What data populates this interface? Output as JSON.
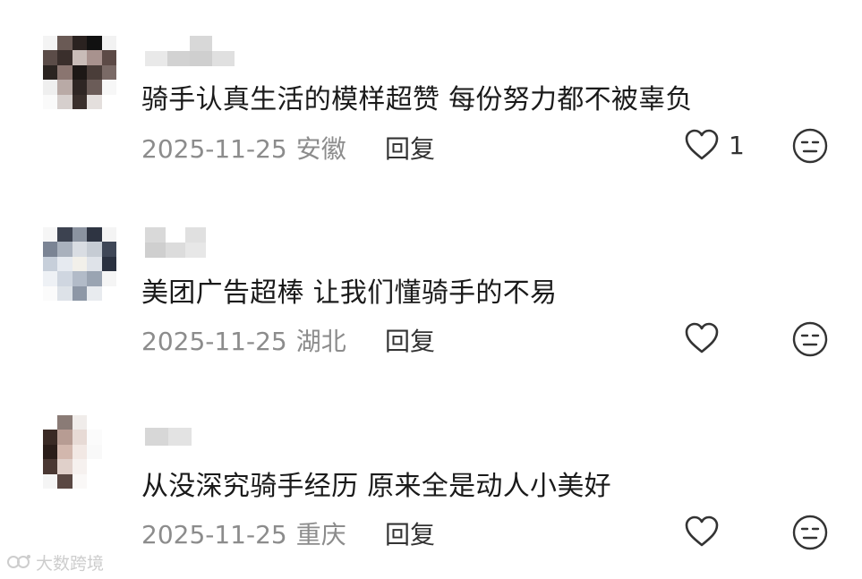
{
  "comments": [
    {
      "text": "骑手认真生活的模样超赞 每份努力都不被辜负",
      "date": "2025-11-25",
      "location": "安徽",
      "reply_label": "回复",
      "like_count": "1",
      "like_icon": "heart-outline-icon",
      "dislike_icon": "neutral-face-icon"
    },
    {
      "text": "美团广告超棒 让我们懂骑手的不易",
      "date": "2025-11-25",
      "location": "湖北",
      "reply_label": "回复",
      "like_count": "",
      "like_icon": "heart-outline-icon",
      "dislike_icon": "neutral-face-icon"
    },
    {
      "text": "从没深究骑手经历 原来全是动人小美好",
      "date": "2025-11-25",
      "location": "重庆",
      "reply_label": "回复",
      "like_count": "",
      "like_icon": "heart-outline-icon",
      "dislike_icon": "neutral-face-icon"
    }
  ],
  "watermark": {
    "text": "大数跨境"
  },
  "colors": {
    "text_primary": "#1a1a1a",
    "text_meta": "#8c8c8c",
    "icon": "#333333"
  }
}
